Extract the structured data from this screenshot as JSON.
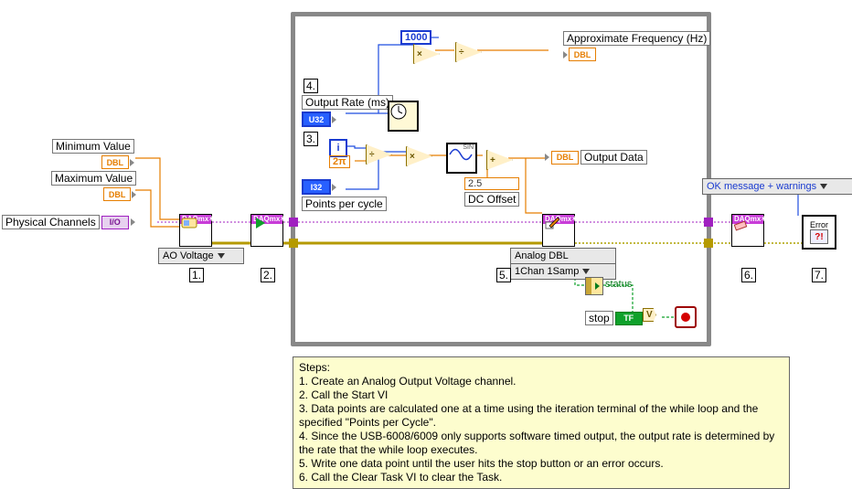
{
  "controls": {
    "min_value_label": "Minimum Value",
    "max_value_label": "Maximum Value",
    "phys_chan_label": "Physical Channels",
    "output_rate_label": "Output Rate (ms)",
    "points_per_cycle_label": "Points per cycle",
    "dc_offset_label": "DC Offset",
    "dc_offset_value": "2.5",
    "approx_freq_label": "Approximate Frequency (Hz)",
    "output_data_label": "Output Data",
    "thousand_const": "1000",
    "two_pi_const": "2π",
    "iter_i": "i",
    "stop_label": "stop",
    "status_label": "status",
    "ok_msg_label": "OK message + warnings"
  },
  "terminals": {
    "dbl": "DBL",
    "u32": "U32",
    "i32": "I32",
    "tf": "TF",
    "io": "I/O"
  },
  "rings": {
    "ao_voltage": "AO Voltage",
    "analog_dbl_1": "Analog DBL",
    "analog_dbl_2": "1Chan 1Samp"
  },
  "daq": {
    "hdr": "DAQmx"
  },
  "steps": {
    "s1": "1.",
    "s2": "2.",
    "s3": "3.",
    "s4": "4.",
    "s5": "5.",
    "s6": "6.",
    "s7": "7."
  },
  "notes": {
    "title": "Steps:",
    "l1": "1.  Create an Analog Output Voltage channel.",
    "l2": "2.  Call the Start VI",
    "l3": "3.  Data points are calculated one at a time using the iteration terminal of the while loop and the specified \"Points per Cycle\".",
    "l4": "4.  Since the USB-6008/6009 only supports software timed output, the output rate is determined by the rate that the while loop executes.",
    "l5": "5.  Write one data point until the user hits the stop button or an error occurs.",
    "l6": "6.  Call the Clear Task VI to clear the Task."
  }
}
